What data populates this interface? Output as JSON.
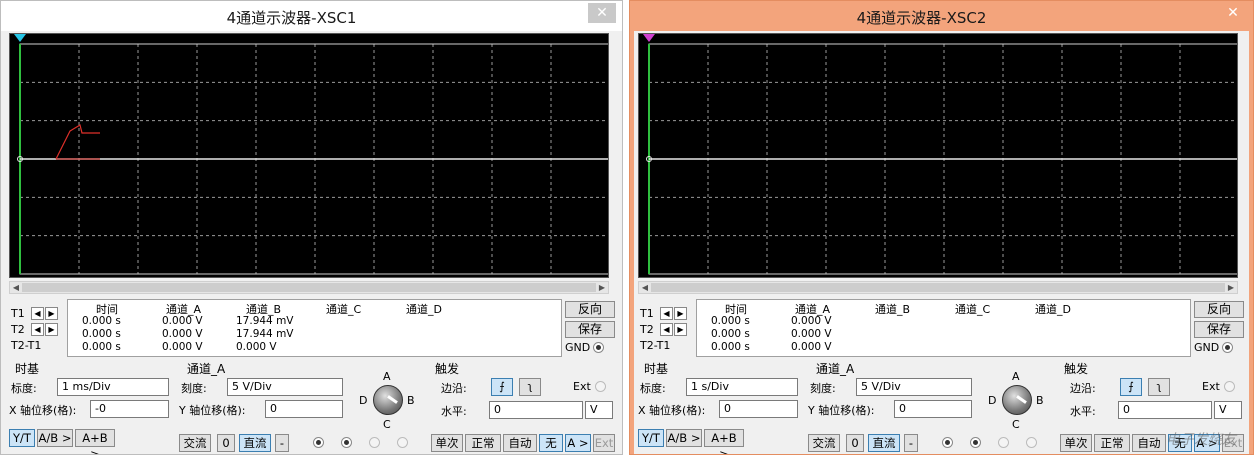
{
  "windows": [
    {
      "title": "4通道示波器-XSC1",
      "close_glyph": "✕",
      "cursor_rows": [
        "T1",
        "T2",
        "T2-T1"
      ],
      "readout": {
        "headers": [
          "时间",
          "通道_A",
          "通道_B",
          "通道_C",
          "通道_D"
        ],
        "rows": [
          [
            "0.000 s",
            "0.000 V",
            "17.944 mV"
          ],
          [
            "0.000 s",
            "0.000 V",
            "17.944 mV"
          ],
          [
            "0.000 s",
            "0.000 V",
            "0.000 V"
          ]
        ]
      },
      "side_buttons": {
        "reverse": "反向",
        "save": "保存",
        "gnd": "GND"
      },
      "timebase": {
        "title": "时基",
        "scale_label": "标度:",
        "scale_value": "1 ms/Div",
        "xpos_label": "X 轴位移(格):",
        "xpos_value": "-0",
        "buttons": [
          "Y/T",
          "A/B >",
          "A+B >"
        ]
      },
      "channel": {
        "title": "通道_A",
        "scale_label": "刻度:",
        "scale_value": "5  V/Div",
        "ypos_label": "Y 轴位移(格):",
        "ypos_value": "0",
        "coupling": [
          "交流",
          "0",
          "直流",
          "-"
        ]
      },
      "knob": {
        "labels": [
          "A",
          "B",
          "C",
          "D"
        ]
      },
      "trigger": {
        "title": "触发",
        "edge_label": "边沿:",
        "ext_label": "Ext",
        "level_label": "水平:",
        "level_value": "0",
        "level_unit": "V",
        "modes": [
          "单次",
          "正常",
          "自动",
          "无",
          "A >",
          "Ext"
        ]
      },
      "marker_labels": [
        "1",
        "2"
      ]
    },
    {
      "title": "4通道示波器-XSC2",
      "close_glyph": "✕",
      "cursor_rows": [
        "T1",
        "T2",
        "T2-T1"
      ],
      "readout": {
        "headers": [
          "时间",
          "通道_A",
          "通道_B",
          "通道_C",
          "通道_D"
        ],
        "rows": [
          [
            "0.000 s",
            "0.000 V"
          ],
          [
            "0.000 s",
            "0.000 V"
          ],
          [
            "0.000 s",
            "0.000 V"
          ]
        ]
      },
      "side_buttons": {
        "reverse": "反向",
        "save": "保存",
        "gnd": "GND"
      },
      "timebase": {
        "title": "时基",
        "scale_label": "标度:",
        "scale_value": "1 s/Div",
        "xpos_label": "X 轴位移(格):",
        "xpos_value": "0",
        "buttons": [
          "Y/T",
          "A/B >",
          "A+B >"
        ]
      },
      "channel": {
        "title": "通道_A",
        "scale_label": "刻度:",
        "scale_value": "5  V/Div",
        "ypos_label": "Y 轴位移(格):",
        "ypos_value": "0",
        "coupling": [
          "交流",
          "0",
          "直流",
          "-"
        ]
      },
      "knob": {
        "labels": [
          "A",
          "B",
          "C",
          "D"
        ]
      },
      "trigger": {
        "title": "触发",
        "edge_label": "边沿:",
        "ext_label": "Ext",
        "level_label": "水平:",
        "level_value": "0",
        "level_unit": "V",
        "modes": [
          "单次",
          "正常",
          "自动",
          "无",
          "A >",
          "Ext"
        ]
      },
      "marker_labels": [
        "1",
        "2"
      ]
    }
  ],
  "watermark": "电子发烧友",
  "colors": {
    "trace_red": "#e0302a",
    "trace_white": "#e8e8e8",
    "grid": "#9a9a9a",
    "border_green": "#2fbf3f",
    "cursor_cyan": "#27c5e6",
    "cursor_magenta": "#d040d0"
  }
}
